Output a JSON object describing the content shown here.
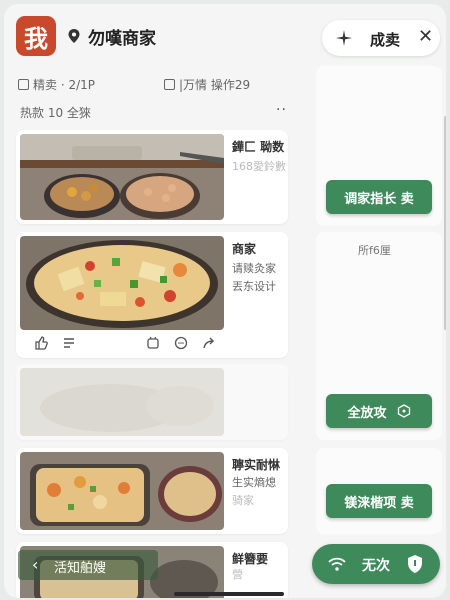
{
  "header": {
    "logo_char": "我",
    "title": "勿嘆商家",
    "pill_label": "成卖",
    "close_glyph": "✕"
  },
  "meta": {
    "left": "精卖 · 2/1P",
    "right": "|万情 操作29"
  },
  "section": {
    "label": "热款 10 全猍",
    "more": "··"
  },
  "cards": [
    {
      "title": "鏵匚 聈数",
      "sub": "168愛鈴數"
    },
    {
      "title": "商家",
      "sub": "请赎灸家",
      "sub2": "丟东设计"
    },
    {
      "title": "",
      "sub": ""
    },
    {
      "title": "聹实耐惏",
      "sub": "生实熵熄",
      "sub2": "骑家"
    },
    {
      "title": "鲜簪要",
      "sub": "營",
      "sub2": "營"
    }
  ],
  "right_panel": {
    "btn1": "调家指长 卖",
    "note": "所f6厘",
    "btn2": "全放攻",
    "btn3": "镁涞楷项 卖"
  },
  "bottom": {
    "pill_label": "无次",
    "back_label": "活知舶嫂"
  },
  "colors": {
    "brand": "#c9492c",
    "accent_green": "#3f8a5b"
  }
}
